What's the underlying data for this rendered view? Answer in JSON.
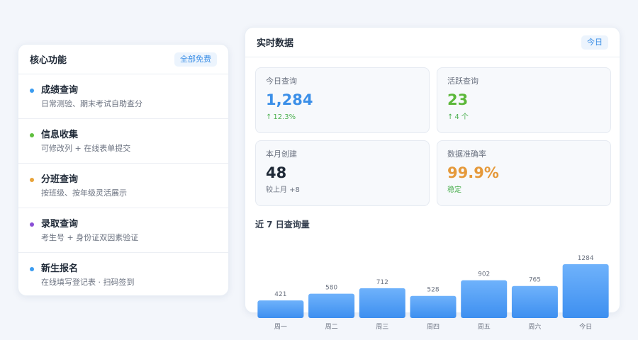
{
  "features": {
    "title": "核心功能",
    "tag": "全部免费",
    "items": [
      {
        "name": "成绩查询",
        "desc": "日常测验、期末考试自助查分",
        "color": "#3b9cf0"
      },
      {
        "name": "信息收集",
        "desc": "可修改列 + 在线表单提交",
        "color": "#5fbf3f"
      },
      {
        "name": "分班查询",
        "desc": "按班级、按年级灵活展示",
        "color": "#e8a33a"
      },
      {
        "name": "录取查询",
        "desc": "考生号 + 身份证双因素验证",
        "color": "#8a4fd6"
      },
      {
        "name": "新生报名",
        "desc": "在线填写登记表 · 扫码签到",
        "color": "#3b9cf0"
      }
    ]
  },
  "realtime": {
    "title": "实时数据",
    "tag": "今日",
    "stats": [
      {
        "label": "今日查询",
        "value": "1,284",
        "value_color": "#3b8fe8",
        "sub": "12.3%",
        "sub_color": "#4cb050",
        "arrow": "↑"
      },
      {
        "label": "活跃查询",
        "value": "23",
        "value_color": "#5cb83a",
        "sub": "4 个",
        "sub_color": "#4cb050",
        "arrow": "↑"
      },
      {
        "label": "本月创建",
        "value": "48",
        "value_color": "#1f2937",
        "sub": "较上月 +8",
        "sub_color": "#6b7280",
        "arrow": ""
      },
      {
        "label": "数据准确率",
        "value": "99.9%",
        "value_color": "#e5993a",
        "sub": "稳定",
        "sub_color": "#4cb050",
        "arrow": ""
      }
    ],
    "chart_title": "近 7 日查询量"
  },
  "chart_data": {
    "type": "bar",
    "title": "近 7 日查询量",
    "categories": [
      "周一",
      "周二",
      "周三",
      "周四",
      "周五",
      "周六",
      "今日"
    ],
    "values": [
      421,
      580,
      712,
      528,
      902,
      765,
      1284
    ],
    "ylim": [
      0,
      1284
    ],
    "grid": false,
    "bar_color_top": "#6fb2fb",
    "bar_color_bottom": "#3d8ff0"
  }
}
